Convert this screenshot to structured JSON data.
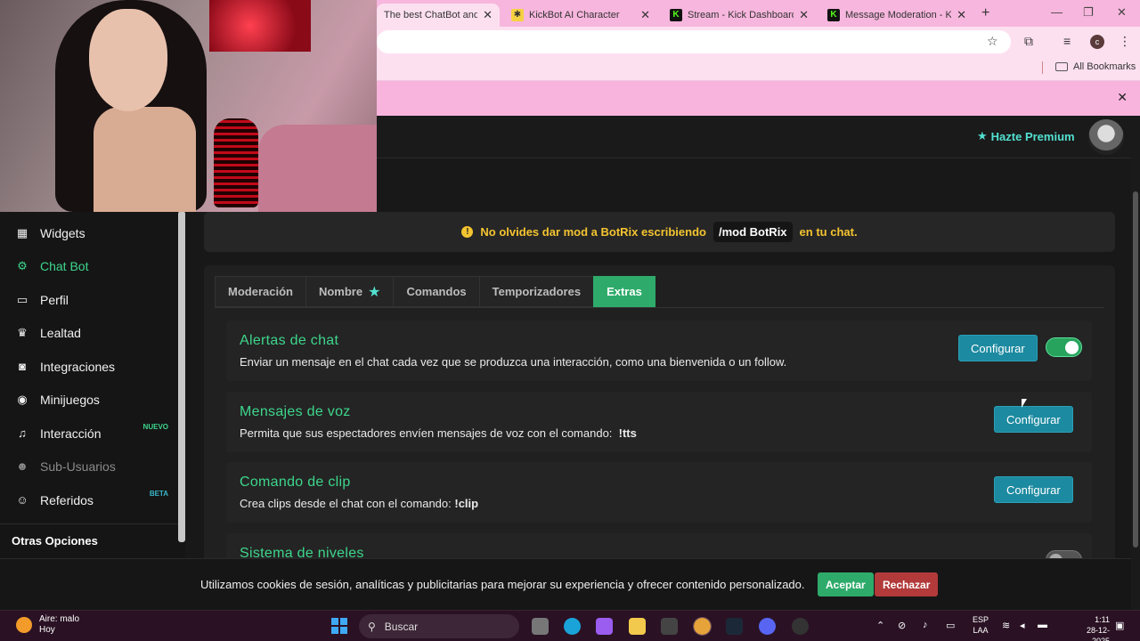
{
  "browser": {
    "tabs": [
      {
        "title": "The best ChatBot and Widgets",
        "active": true
      },
      {
        "title": "KickBot AI Character",
        "active": false
      },
      {
        "title": "Stream - Kick Dashboard",
        "active": false
      },
      {
        "title": "Message Moderation - Kick",
        "active": false
      }
    ],
    "bookmarks_label": "All Bookmarks",
    "profile_initial": "c"
  },
  "header": {
    "premium_label": "Hazte Premium"
  },
  "sidebar": {
    "items": [
      {
        "label": "Widgets",
        "icon": "grid-icon",
        "state": "normal"
      },
      {
        "label": "Chat Bot",
        "icon": "robot-icon",
        "state": "active"
      },
      {
        "label": "Perfil",
        "icon": "id-card-icon",
        "state": "normal"
      },
      {
        "label": "Lealtad",
        "icon": "trophy-icon",
        "state": "normal"
      },
      {
        "label": "Integraciones",
        "icon": "plug-icon",
        "state": "normal"
      },
      {
        "label": "Minijuegos",
        "icon": "gamepad-icon",
        "state": "normal"
      },
      {
        "label": "Interacción",
        "icon": "music-icon",
        "state": "normal",
        "badge": "NUEVO"
      },
      {
        "label": "Sub-Usuarios",
        "icon": "users-icon",
        "state": "dim"
      },
      {
        "label": "Referidos",
        "icon": "user-group-icon",
        "state": "normal",
        "badge": "BETA"
      }
    ],
    "other_options": "Otras Opciones"
  },
  "notice": {
    "before": "No olvides dar mod a BotRix escribiendo",
    "command": "/mod BotRix",
    "after": "en tu chat."
  },
  "tabs": [
    "Moderación",
    "Nombre",
    "Comandos",
    "Temporizadores",
    "Extras"
  ],
  "active_tab": "Extras",
  "cards": [
    {
      "title": "Alertas de chat",
      "desc": "Enviar un mensaje en el chat cada vez que se produzca una interacción, como una bienvenida o un follow.",
      "button": "Configurar",
      "toggle": "on"
    },
    {
      "title": "Mensajes de voz",
      "desc": "Permita que sus espectadores envíen mensajes de voz con el comando:",
      "command": "!tts",
      "button": "Configurar"
    },
    {
      "title": "Comando de clip",
      "desc": "Crea clips desde el chat con el comando:",
      "command": "!clip",
      "button": "Configurar"
    },
    {
      "title": "Sistema de niveles",
      "toggle": "off"
    }
  ],
  "cookie": {
    "text": "Utilizamos cookies de sesión, analíticas y publicitarias para mejorar su experiencia y ofrecer contenido personalizado.",
    "accept": "Aceptar",
    "reject": "Rechazar"
  },
  "taskbar": {
    "weather_line1": "Aire: malo",
    "weather_line2": "Hoy",
    "search_placeholder": "Buscar",
    "lang_line1": "ESP",
    "lang_line2": "LAA",
    "time": "1:11",
    "date": "28-12-2025"
  },
  "colors": {
    "accent_green": "#3dd68c",
    "button_teal": "#1c8aa0",
    "warning_yellow": "#f4c430",
    "reject_red": "#b23a3a"
  }
}
